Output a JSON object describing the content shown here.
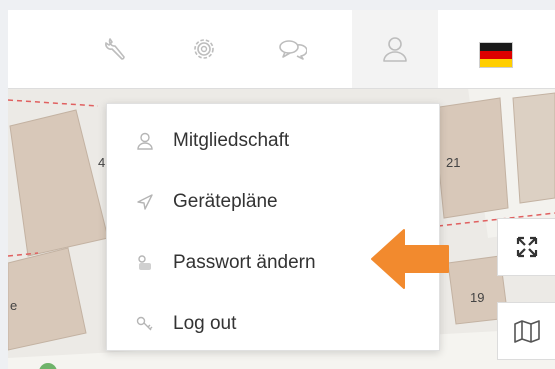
{
  "toolbar": {
    "icons": [
      "wrench-icon",
      "gear-icon",
      "chat-icon",
      "user-icon"
    ],
    "language_flag": "german-flag"
  },
  "user_menu": {
    "items": [
      {
        "icon": "user-icon",
        "label": "Mitgliedschaft"
      },
      {
        "icon": "send-icon",
        "label": "Gerätepläne"
      },
      {
        "icon": "key-lock-icon",
        "label": "Passwort ändern"
      },
      {
        "icon": "key-icon",
        "label": "Log out"
      }
    ]
  },
  "map": {
    "labels": {
      "house_4": "4",
      "house_21": "21",
      "house_19": "19",
      "street_fragment": "e"
    }
  },
  "colors": {
    "accent_arrow": "#f28a2e",
    "building_fill": "#d8c8b9",
    "road_fill": "#f5f4f0",
    "boundary_dash": "#e06060"
  }
}
